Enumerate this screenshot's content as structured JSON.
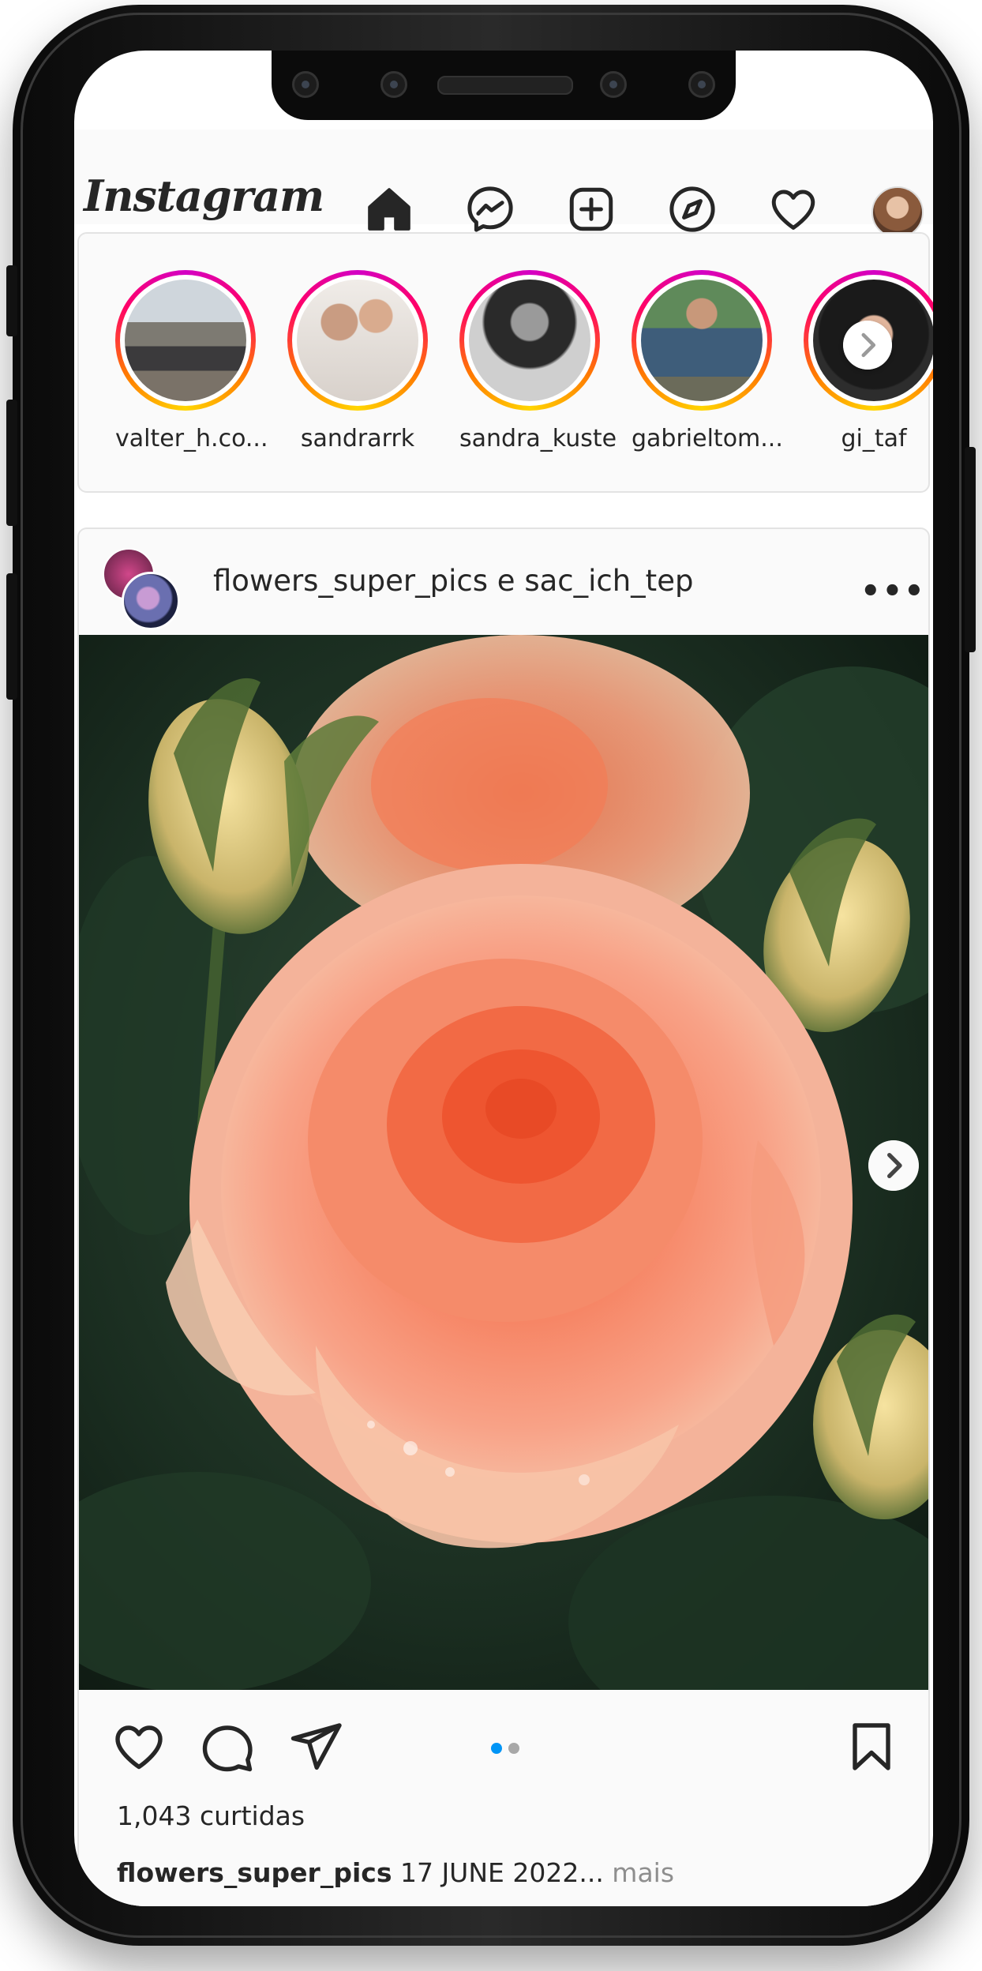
{
  "app": {
    "logo_text": "Instagram"
  },
  "nav": {
    "icons": [
      "home-icon",
      "messenger-icon",
      "new-post-icon",
      "explore-icon",
      "activity-heart-icon",
      "profile-avatar"
    ]
  },
  "stories": [
    {
      "name": "valter_h.co..."
    },
    {
      "name": "sandrarrk"
    },
    {
      "name": "sandra_kuste"
    },
    {
      "name": "gabrieltom..."
    },
    {
      "name": "gi_taf"
    }
  ],
  "post": {
    "header_user": "flowers_super_pics e sac_ich_tep",
    "more_label": "•••",
    "likes": "1,043 curtidas",
    "caption_user": "flowers_super_pics",
    "caption_text": " 17 JUNE 2022...",
    "caption_more": " mais",
    "carousel": {
      "count": 2,
      "active": 0,
      "active_color": "#0095f6",
      "inactive_color": "#a8a8a8"
    }
  },
  "colors": {
    "text": "#262626",
    "story_ring": [
      "#d300c5",
      "#ff0069",
      "#ff7a00",
      "#ffd600"
    ],
    "photo_subject": "#f59a84"
  }
}
